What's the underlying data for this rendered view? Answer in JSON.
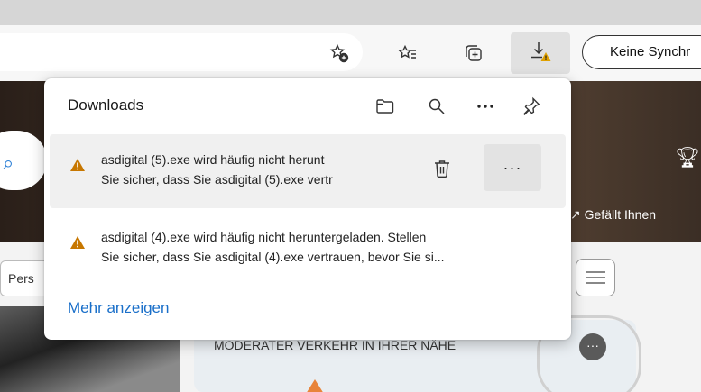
{
  "toolbar": {
    "icons": [
      "add-to-favorites-icon",
      "favorites-icon",
      "collections-icon",
      "downloads-icon"
    ],
    "sync_button_label": "Keine Synchr"
  },
  "downloads_panel": {
    "title": "Downloads",
    "header_icons": [
      "open-folder-icon",
      "search-icon",
      "more-options-icon",
      "pin-icon"
    ],
    "items": [
      {
        "line1": "asdigital (5).exe wird häufig nicht herunt",
        "line2": "Sie sicher, dass Sie asdigital (5).exe vertr",
        "status_icon": "warning-icon",
        "delete_icon": "trash-icon",
        "more_label": "···"
      },
      {
        "line1": "asdigital (4).exe wird häufig nicht heruntergeladen. Stellen",
        "line2": "Sie sicher, dass Sie asdigital (4).exe vertrauen, bevor Sie si...",
        "status_icon": "warning-icon"
      }
    ],
    "show_more_label": "Mehr anzeigen"
  },
  "page": {
    "like_label": "Gefällt Ihnen",
    "filter_label": "Pers",
    "traffic_card": {
      "title": "MODERATER VERKEHR IN IHRER NÄHE",
      "more_label": "···"
    }
  },
  "colors": {
    "accent_link": "#1a6fc9",
    "warning": "#c77700",
    "panel_bg": "#ffffff",
    "toolbar_bg": "#f7f7f7"
  }
}
